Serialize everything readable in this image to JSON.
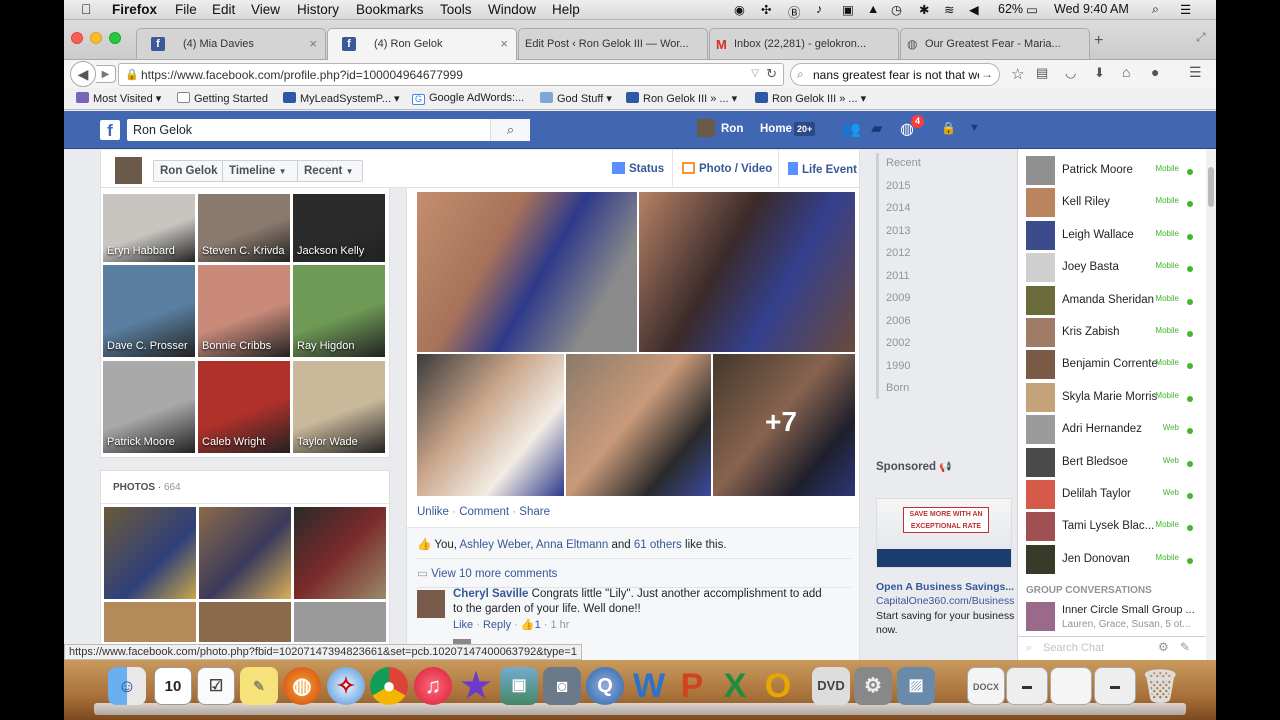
{
  "menubar": {
    "app": "Firefox",
    "items": [
      "File",
      "Edit",
      "View",
      "History",
      "Bookmarks",
      "Tools",
      "Window",
      "Help"
    ],
    "battery": "62%",
    "clock": "Wed 9:40 AM"
  },
  "tabs": [
    {
      "label": "(4) Mia Davies",
      "favicon": "facebook-icon"
    },
    {
      "label": "(4) Ron Gelok",
      "favicon": "facebook-icon",
      "active": true
    },
    {
      "label": "Edit Post ‹ Ron Gelok III — Wor...",
      "favicon": "wordpress-icon"
    },
    {
      "label": "Inbox (22,281) - gelokron...",
      "favicon": "gmail-icon"
    },
    {
      "label": "Our Greatest Fear - Maria...",
      "favicon": "globe-icon"
    }
  ],
  "url": "https://www.facebook.com/profile.php?id=100004964677999",
  "search_value": "nans greatest fear is not that we",
  "bookmarks": [
    "Most Visited",
    "Getting Started",
    "MyLeadSystemP...",
    "Google AdWords:...",
    "God Stuff",
    "Ron Gelok III » ...",
    "Ron Gelok III » ..."
  ],
  "fb": {
    "search_value": "Ron Gelok",
    "user_name": "Ron",
    "home": "Home",
    "home_count": "20+",
    "notif_count": "4"
  },
  "profile_bar": {
    "name": "Ron Gelok",
    "timeline": "Timeline",
    "recent": "Recent",
    "status": "Status",
    "photo_video": "Photo / Video",
    "life_event": "Life Event"
  },
  "friends": [
    {
      "name": "Eryn Habbard",
      "color": "#c8c5c0"
    },
    {
      "name": "Steven C. Krivda",
      "color": "#8a7a6e"
    },
    {
      "name": "Jackson Kelly",
      "color": "#2b2b2b"
    },
    {
      "name": "Dave C. Prosser",
      "color": "#5a7fa0"
    },
    {
      "name": "Bonnie Cribbs",
      "color": "#c98a7a"
    },
    {
      "name": "Ray Higdon",
      "color": "#6e9a55"
    },
    {
      "name": "Patrick Moore",
      "color": "#a9a9a9"
    },
    {
      "name": "Caleb Wright",
      "color": "#b0302a"
    },
    {
      "name": "Taylor Wade",
      "color": "#c9b89a"
    }
  ],
  "photos_header": {
    "label": "PHOTOS",
    "count": "664"
  },
  "post": {
    "more_photos": "+7",
    "actions": [
      "Unlike",
      "Comment",
      "Share"
    ],
    "likes_prefix": "You,",
    "liker1": "Ashley Weber",
    "liker2": "Anna Eltmann",
    "likes_and": "and",
    "likes_others": "61 others",
    "likes_suffix": "like this.",
    "view_more": "View 10 more comments",
    "comment_author": "Cheryl Saville",
    "comment_text": "Congrats little \"Lily\". Just another accomplishment to add to the garden of your life. Well done!!",
    "comment_like": "Like",
    "comment_reply": "Reply",
    "comment_likes": "1",
    "comment_time": "1 hr"
  },
  "years": [
    "Recent",
    "2015",
    "2014",
    "2013",
    "2012",
    "2011",
    "2009",
    "2006",
    "2002",
    "1990",
    "Born"
  ],
  "sponsored": {
    "label": "Sponsored",
    "ad_text": "SAVE MORE WITH AN EXCEPTIONAL RATE",
    "title": "Open A Business Savings...",
    "domain": "CapitalOne360.com/Business",
    "body": "Start saving for your business now."
  },
  "chat": [
    {
      "name": "Patrick Moore",
      "status": "Mobile",
      "color": "#8f8f8f"
    },
    {
      "name": "Kell Riley",
      "status": "Mobile",
      "color": "#b9845e"
    },
    {
      "name": "Leigh Wallace",
      "status": "Mobile",
      "color": "#3c4b8c"
    },
    {
      "name": "Joey Basta",
      "status": "Mobile",
      "color": "#cfcfcf"
    },
    {
      "name": "Amanda Sheridan",
      "status": "Mobile",
      "color": "#6a6a3a"
    },
    {
      "name": "Kris Zabish",
      "status": "Mobile",
      "color": "#a07b66"
    },
    {
      "name": "Benjamin Corrente",
      "status": "Mobile",
      "color": "#7a5a44"
    },
    {
      "name": "Skyla Marie Morris",
      "status": "Mobile",
      "color": "#c4a27a"
    },
    {
      "name": "Adri Hernandez",
      "status": "Web",
      "color": "#9b9b9b"
    },
    {
      "name": "Bert Bledsoe",
      "status": "Web",
      "color": "#4a4a4a"
    },
    {
      "name": "Delilah Taylor",
      "status": "Web",
      "color": "#d65a4a"
    },
    {
      "name": "Tami Lysek Blac...",
      "status": "Mobile",
      "color": "#a05050"
    },
    {
      "name": "Jen Donovan",
      "status": "Mobile",
      "color": "#3a3a2a"
    }
  ],
  "group": {
    "header": "GROUP CONVERSATIONS",
    "name": "Inner Circle Small Group ...",
    "members": "Lauren, Grace, Susan, 5 ot..."
  },
  "chat_search_placeholder": "Search Chat",
  "status_url": "https://www.facebook.com/photo.php?fbid=10207147394823661&set=pcb.10207147400063792&type=1"
}
